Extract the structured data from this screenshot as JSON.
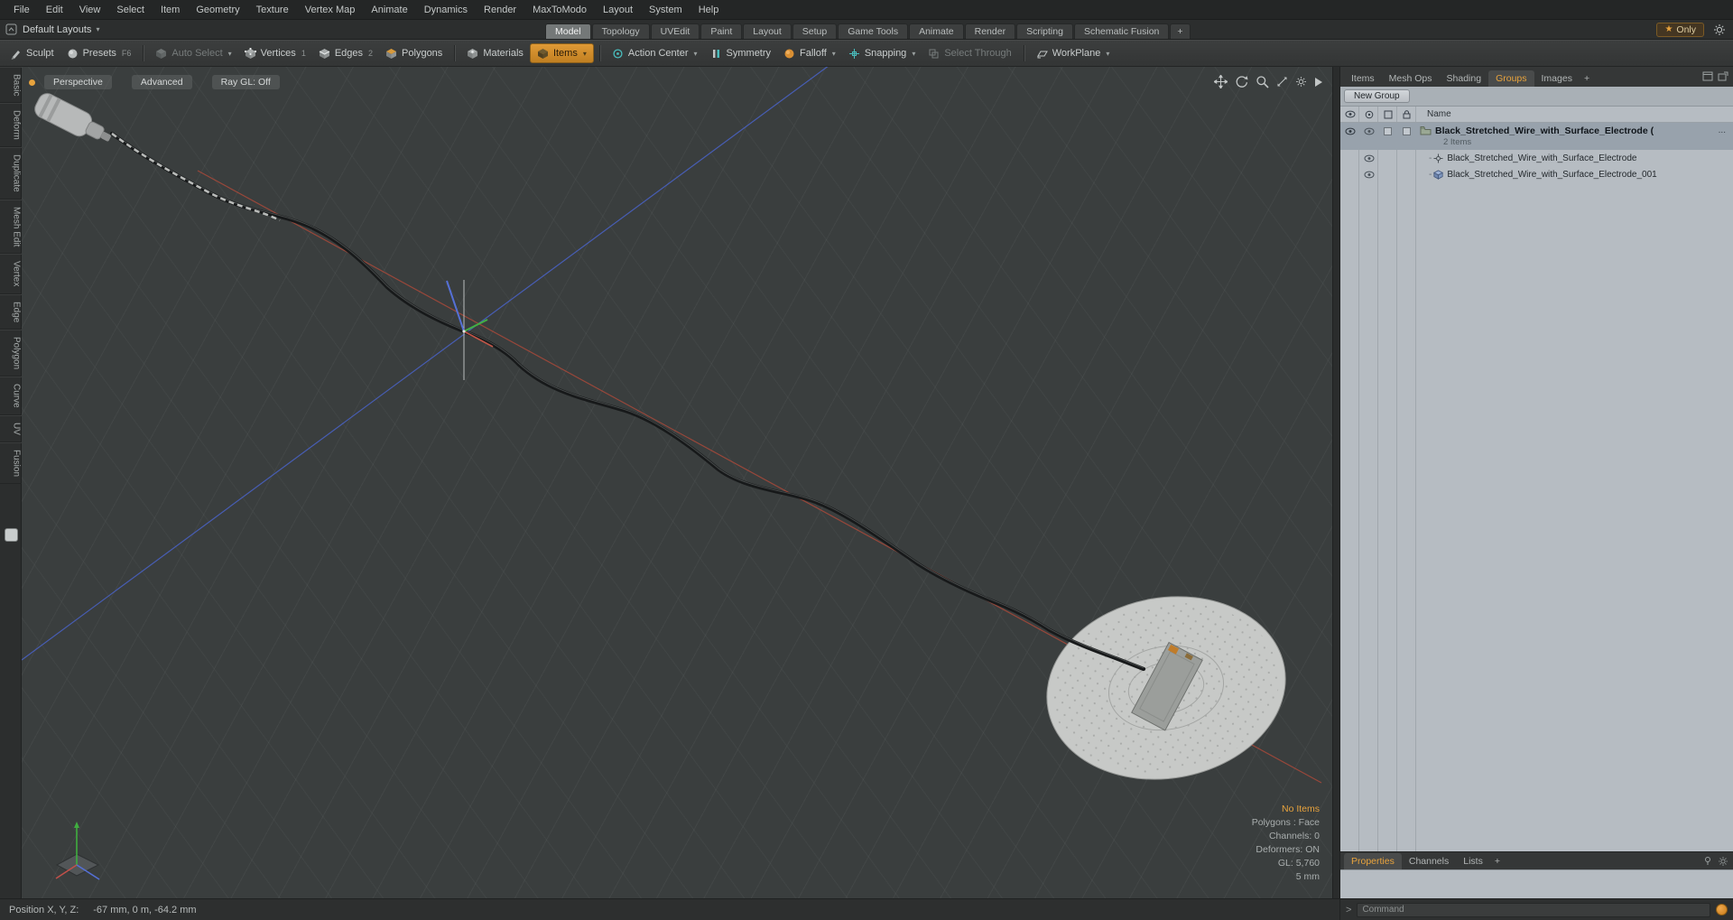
{
  "colors": {
    "accent": "#e8a33d",
    "viewport_bg": "#3a3e3e",
    "panel_light": "#b6bcc2",
    "selection": "#98a2ac",
    "axis_red": "#b04a3a",
    "axis_blue": "#4a63c8",
    "axis_green": "#3fae3f"
  },
  "menubar": {
    "items": [
      "File",
      "Edit",
      "View",
      "Select",
      "Item",
      "Geometry",
      "Texture",
      "Vertex Map",
      "Animate",
      "Dynamics",
      "Render",
      "MaxToModo",
      "Layout",
      "System",
      "Help"
    ]
  },
  "layout_bar": {
    "preset": "Default Layouts",
    "caret": "▾",
    "tabs": [
      "Model",
      "Topology",
      "UVEdit",
      "Paint",
      "Layout",
      "Setup",
      "Game Tools",
      "Animate",
      "Render",
      "Scripting",
      "Schematic Fusion"
    ],
    "active_tab": "Model",
    "add_tab": "+",
    "only_star": "★",
    "only_label": "Only"
  },
  "toolbar": {
    "sculpt": "Sculpt",
    "presets": "Presets",
    "presets_key": "F6",
    "auto_select": "Auto Select",
    "vertices": "Vertices",
    "vertices_key": "1",
    "edges": "Edges",
    "edges_key": "2",
    "polygons": "Polygons",
    "materials": "Materials",
    "items": "Items",
    "action_center": "Action Center",
    "symmetry": "Symmetry",
    "falloff": "Falloff",
    "snapping": "Snapping",
    "select_through": "Select Through",
    "workplane": "WorkPlane",
    "caret": "▾"
  },
  "left_tabs": [
    "Basic",
    "Deform",
    "Duplicate",
    "Mesh Edit",
    "Vertex",
    "Edge",
    "Polygon",
    "Curve",
    "UV",
    "Fusion"
  ],
  "viewport": {
    "buttons": [
      "Perspective",
      "Advanced",
      "Ray GL: Off"
    ],
    "hud": {
      "no_items": "No Items",
      "polygons": "Polygons : Face",
      "channels": "Channels: 0",
      "deformers": "Deformers: ON",
      "gl": "GL: 5,760",
      "grid_size": "5 mm"
    }
  },
  "right_panel": {
    "tabs": [
      "Items",
      "Mesh Ops",
      "Shading",
      "Groups",
      "Images",
      "+"
    ],
    "active_tab": "Groups",
    "new_group_label": "New Group",
    "name_header": "Name",
    "rows": [
      {
        "name": "Black_Stretched_Wire_with_Surface_Electrode (",
        "trail": "...",
        "sub": "2 Items"
      },
      {
        "name": "Black_Stretched_Wire_with_Surface_Electrode"
      },
      {
        "name": "Black_Stretched_Wire_with_Surface_Electrode_001"
      }
    ]
  },
  "bottom_panel": {
    "tabs": [
      "Properties",
      "Channels",
      "Lists",
      "+"
    ],
    "active_tab": "Properties"
  },
  "command": {
    "prompt": ">",
    "placeholder": "Command"
  },
  "status": {
    "label": "Position X, Y, Z:",
    "value": "-67 mm, 0 m, -64.2 mm"
  }
}
